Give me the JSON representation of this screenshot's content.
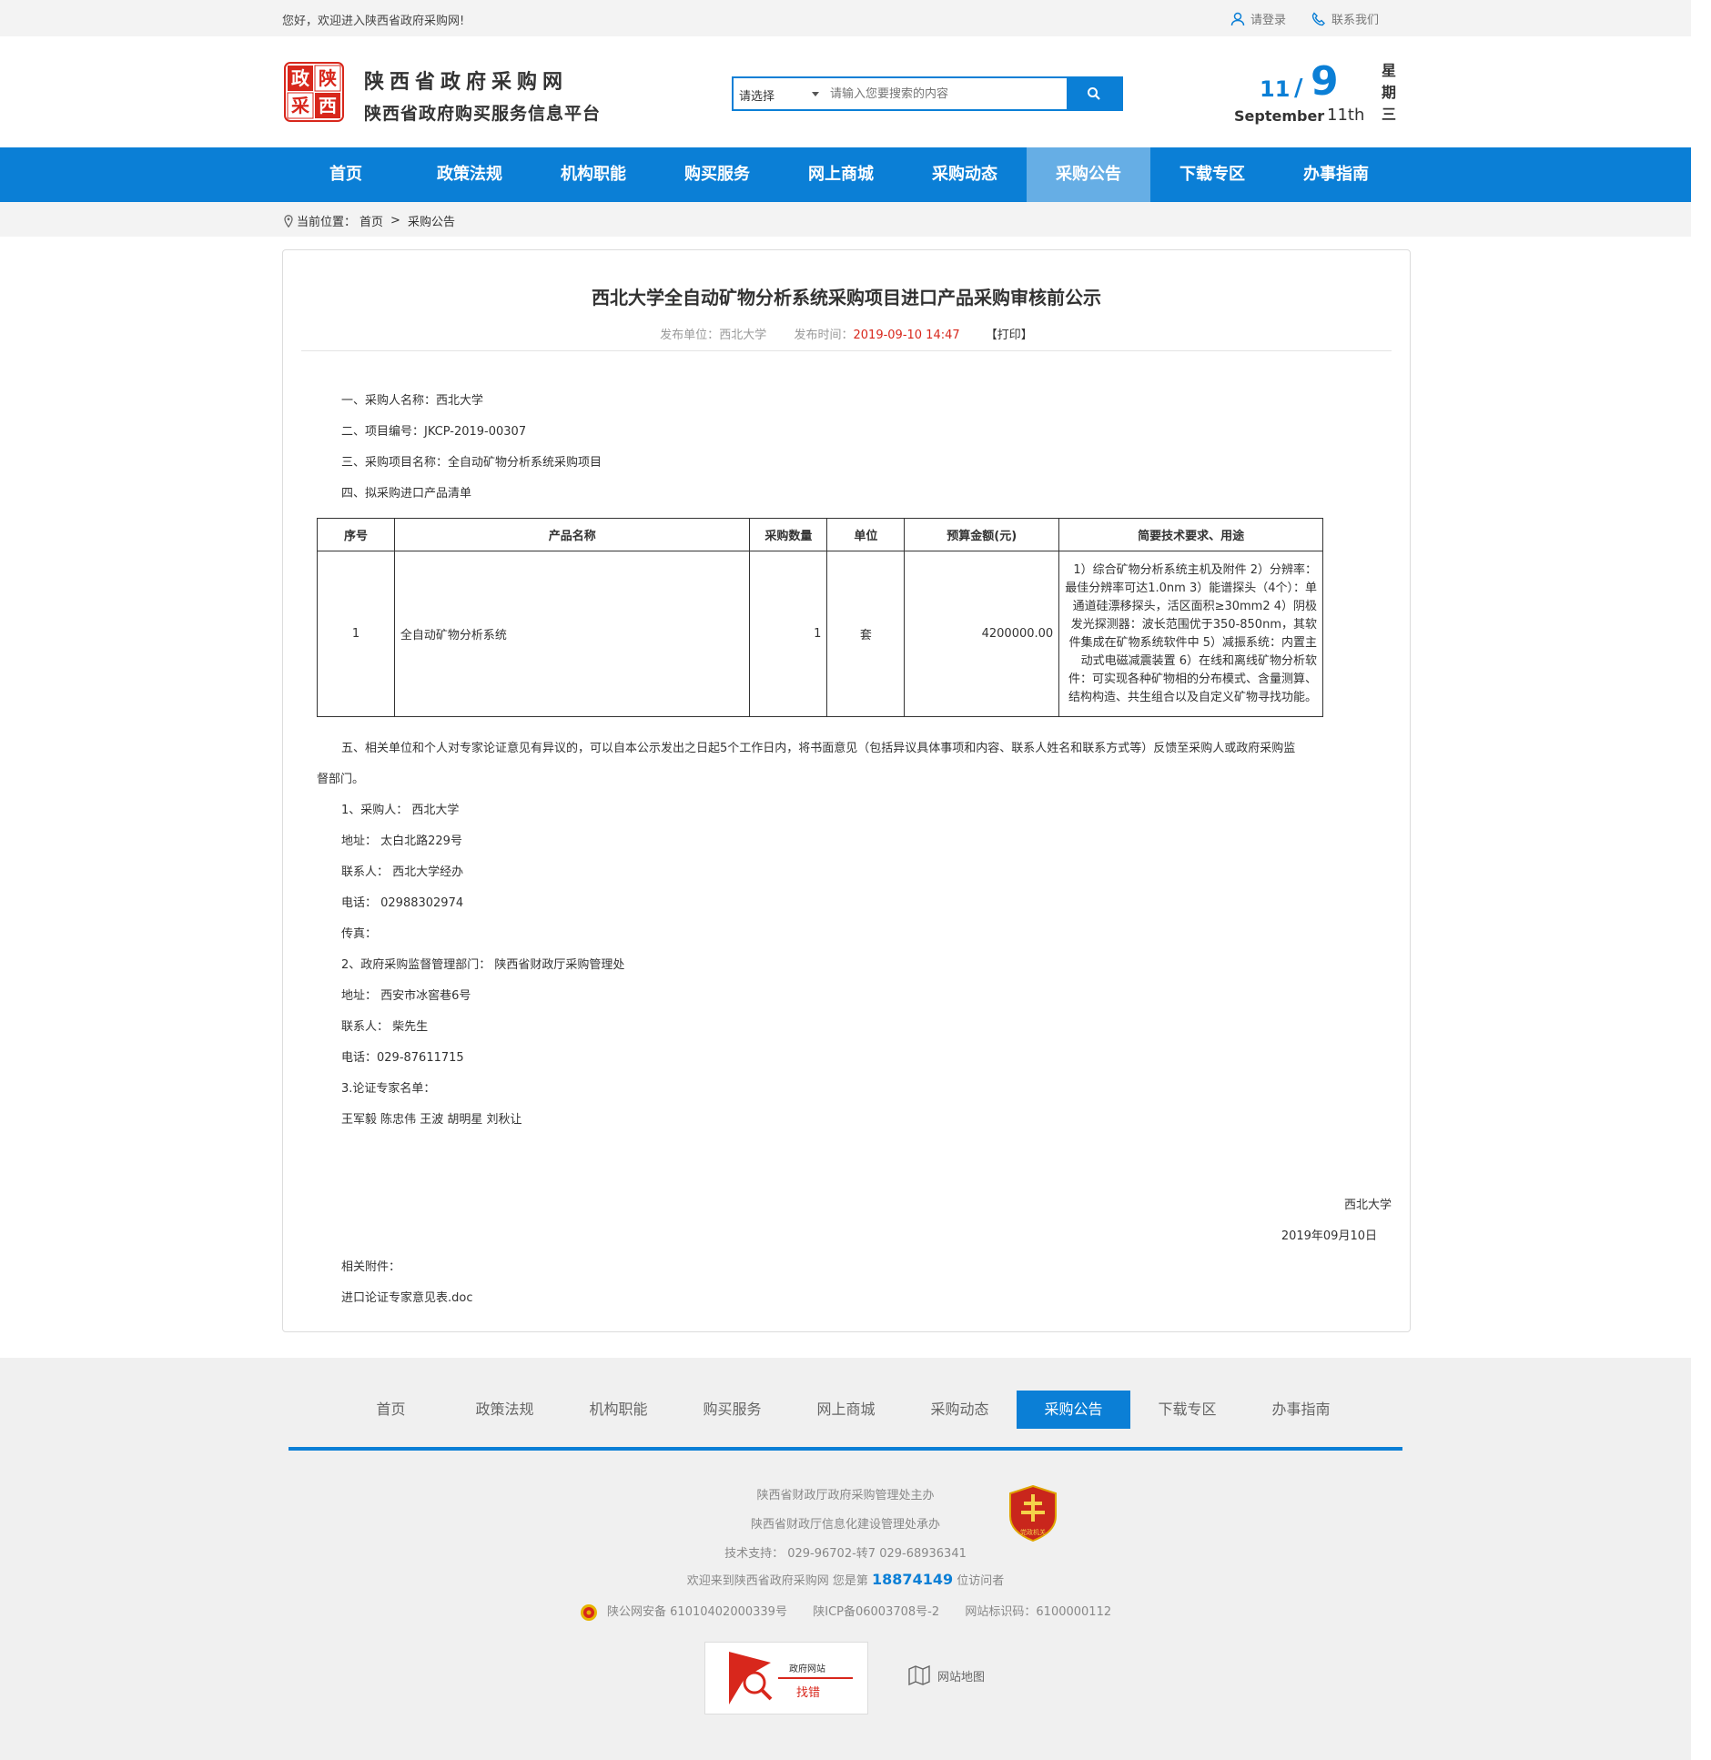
{
  "topbar": {
    "welcome": "您好，欢迎进入陕西省政府采购网!",
    "login": "请登录",
    "contact": "联系我们"
  },
  "header": {
    "logo_chars": [
      "政",
      "陕",
      "采",
      "西"
    ],
    "site_name": "陕西省政府采购网",
    "platform_name": "陕西省政府购买服务信息平台"
  },
  "search": {
    "select_value": "请选择",
    "placeholder": "请输入您要搜索的内容"
  },
  "date": {
    "month_num": "11",
    "slash": "/",
    "day_num": "9",
    "month_name": "September",
    "ordinal": "11th",
    "week": [
      "星",
      "期",
      "三"
    ]
  },
  "nav": {
    "items": [
      "首页",
      "政策法规",
      "机构职能",
      "购买服务",
      "网上商城",
      "采购动态",
      "采购公告",
      "下载专区",
      "办事指南"
    ],
    "active": "采购公告"
  },
  "breadcrumb": {
    "label": "当前位置：",
    "home": "首页",
    "sep": ">",
    "current": "采购公告"
  },
  "article": {
    "title": "西北大学全自动矿物分析系统采购项目进口产品采购审核前公示",
    "publisher_label": "发布单位：",
    "publisher": "西北大学",
    "time_label": "发布时间：",
    "time": "2019-09-10 14:47",
    "print": "【打印】",
    "lines": {
      "l1": "一、采购人名称：西北大学",
      "l2": "二、项目编号：JKCP-2019-00307",
      "l3": "三、采购项目名称：全自动矿物分析系统采购项目",
      "l4": "四、拟采购进口产品清单",
      "l5a": "五、相关单位和个人对专家论证意见有异议的，可以自本公示发出之日起5个工作日内，将书面意见（包括异议具体事项和内容、联系人姓名和联系方式等）反馈至采购人或政府采购监",
      "l5b": "督部门。",
      "c1": "1、采购人： 西北大学",
      "c2": "地址： 太白北路229号",
      "c3": "联系人： 西北大学经办",
      "c4": "电话： 02988302974",
      "c5": "传真：",
      "c6": "2、政府采购监督管理部门： 陕西省财政厅采购管理处",
      "c7": "地址： 西安市冰窖巷6号",
      "c8": "联系人： 柴先生",
      "c9": "电话：029-87611715",
      "c10": "3.论证专家名单：",
      "c11": "王军毅  陈忠伟  王波  胡明星  刘秋让",
      "sign_org": "西北大学",
      "sign_date": "2019年09月10日",
      "attach_label": "相关附件：",
      "attach_file": "进口论证专家意见表.doc"
    },
    "table": {
      "headers": [
        "序号",
        "产品名称",
        "采购数量",
        "单位",
        "预算金额(元)",
        "简要技术要求、用途"
      ],
      "row": {
        "no": "1",
        "name": "全自动矿物分析系统",
        "qty": "1",
        "unit": "套",
        "budget": "4200000.00",
        "req": "1）综合矿物分析系统主机及附件 2）分辨率：最佳分辨率可达1.0nm 3）能谱探头（4个）：单通道硅漂移探头，活区面积≥30mm2 4）阴极发光探测器：波长范围优于350-850nm，其软件集成在矿物系统软件中 5）减振系统：内置主动式电磁减震装置 6）在线和离线矿物分析软件：可实现各种矿物相的分布模式、含量测算、结构构造、共生组合以及自定义矿物寻找功能。"
      }
    }
  },
  "footer": {
    "nav": [
      "首页",
      "政策法规",
      "机构职能",
      "购买服务",
      "网上商城",
      "采购动态",
      "采购公告",
      "下载专区",
      "办事指南"
    ],
    "active": "采购公告",
    "host": "陕西省财政厅政府采购管理处主办",
    "organizer": "陕西省财政厅信息化建设管理处承办",
    "support": "技术支持： 029-96702-转7    029-68936341",
    "welcome_pre": "欢迎来到陕西省政府采购网    您是第",
    "visitor_count": "18874149",
    "welcome_post": "位访问者",
    "police": "陕公网安备 61010402000339号",
    "icp": "陕ICP备06003708号-2",
    "site_id": "网站标识码：6100000112",
    "emblem_text": "党政机关",
    "badge_top": "政府网站",
    "badge_bottom": "找错",
    "sitemap": "网站地图"
  },
  "colors": {
    "brand": "#0b7fd6",
    "nav_active": "#66aee5",
    "logo_red": "#d8271c",
    "date_red": "#d8271c"
  }
}
